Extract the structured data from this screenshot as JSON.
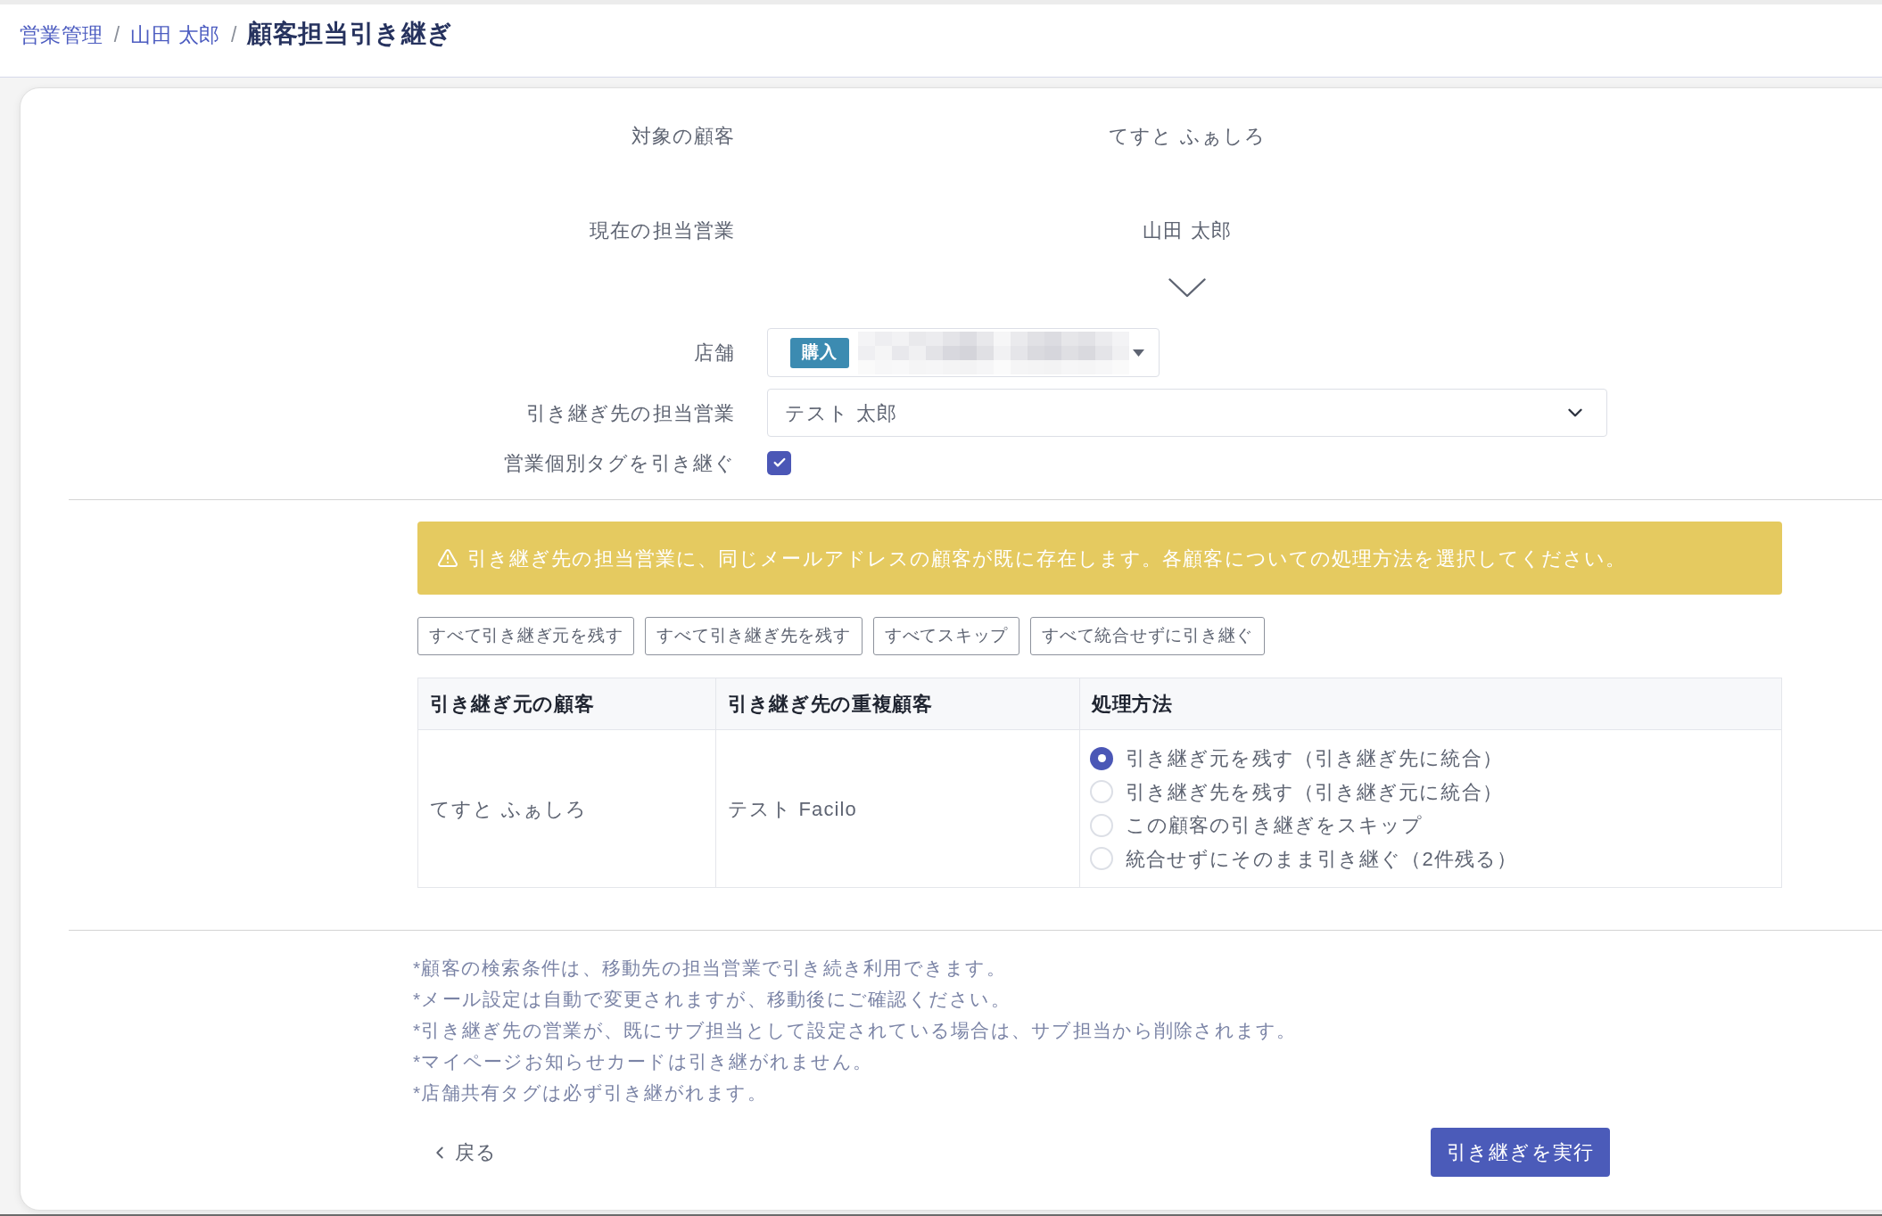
{
  "breadcrumb": [
    {
      "kind": "link",
      "text": "営業管理"
    },
    {
      "kind": "separator",
      "text": "/"
    },
    {
      "kind": "link",
      "text": "山田 太郎"
    },
    {
      "kind": "separator",
      "text": "/"
    },
    {
      "kind": "current",
      "text": "顧客担当引き継ぎ"
    }
  ],
  "form": {
    "target_customer": {
      "label": "対象の顧客",
      "value": "てすと ふぁしろ"
    },
    "current_sales": {
      "label": "現在の担当営業",
      "value": "山田 太郎"
    },
    "store": {
      "label": "店舗",
      "badge": "購入"
    },
    "new_sales": {
      "label": "引き継ぎ先の担当営業",
      "value": "テスト 太郎"
    },
    "inherit_tags": {
      "label": "営業個別タグを引き継ぐ",
      "checked": true
    }
  },
  "warning": {
    "text": "引き継ぎ先の担当営業に、同じメールアドレスの顧客が既に存在します。各顧客についての処理方法を選択してください。"
  },
  "bulk_actions": [
    "すべて引き継ぎ元を残す",
    "すべて引き継ぎ先を残す",
    "すべてスキップ",
    "すべて統合せずに引き継ぐ"
  ],
  "table": {
    "columns": [
      "引き継ぎ元の顧客",
      "引き継ぎ先の重複顧客",
      "処理方法"
    ],
    "rows": [
      {
        "source_customer": "てすと ふぁしろ",
        "duplicate_customer": "テスト Facilo",
        "options": [
          {
            "label": "引き継ぎ元を残す（引き継ぎ先に統合）",
            "selected": true
          },
          {
            "label": "引き継ぎ先を残す（引き継ぎ元に統合）",
            "selected": false
          },
          {
            "label": "この顧客の引き継ぎをスキップ",
            "selected": false
          },
          {
            "label": "統合せずにそのまま引き継ぐ（2件残る）",
            "selected": false
          }
        ]
      }
    ]
  },
  "notes": [
    "*顧客の検索条件は、移動先の担当営業で引き続き利用できます。",
    "*メール設定は自動で変更されますが、移動後にご確認ください。",
    "*引き継ぎ先の営業が、既にサブ担当として設定されている場合は、サブ担当から削除されます。",
    "*マイページお知らせカードは引き継がれません。",
    "*店舗共有タグは必ず引き継がれます。"
  ],
  "footer": {
    "back_link": "戻る",
    "submit_button": "引き継ぎを実行"
  }
}
